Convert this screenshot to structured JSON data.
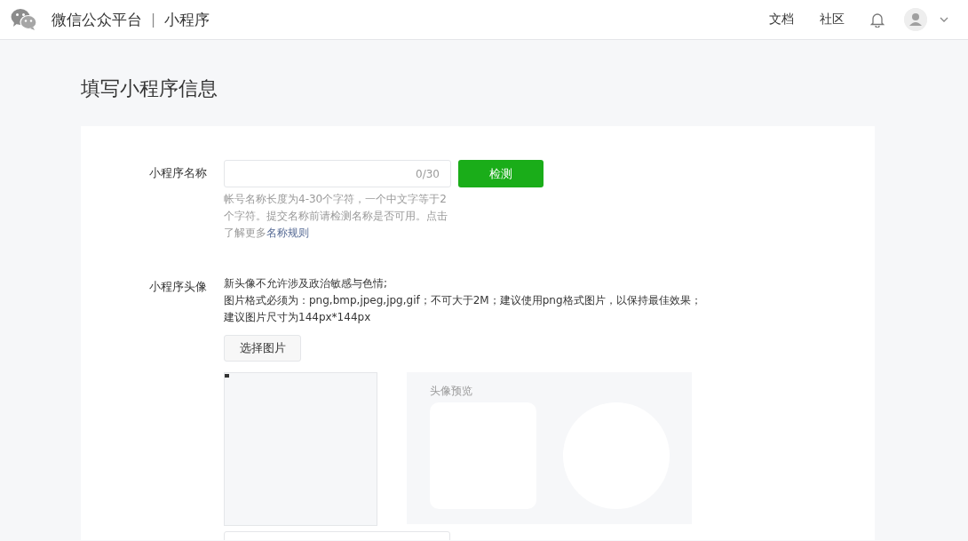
{
  "header": {
    "brand": "微信公众平台",
    "separator": "|",
    "product": "小程序",
    "nav": [
      "文档",
      "社区"
    ]
  },
  "page_title": "填写小程序信息",
  "name_field": {
    "label": "小程序名称",
    "counter": "0/30",
    "button": "检测",
    "help": "帐号名称长度为4-30个字符，一个中文字等于2个字符。提交名称前请检测名称是否可用。点击了解更多",
    "help_link": "名称规则"
  },
  "avatar_field": {
    "label": "小程序头像",
    "notes": [
      "新头像不允许涉及政治敏感与色情;",
      "图片格式必须为：png,bmp,jpeg,jpg,gif；不可大于2M；建议使用png格式图片，以保持最佳效果；",
      "建议图片尺寸为144px*144px"
    ],
    "button": "选择图片",
    "preview_label": "头像预览"
  }
}
